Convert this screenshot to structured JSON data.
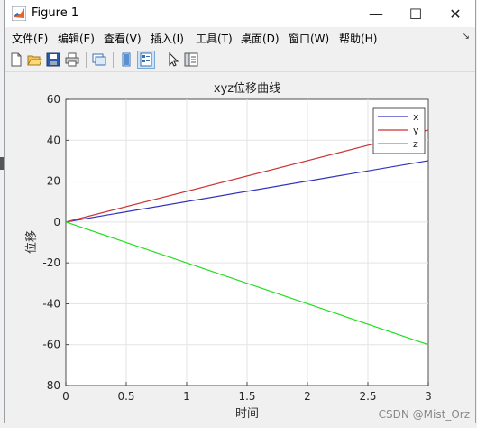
{
  "window": {
    "title": "Figure 1",
    "minimize_glyph": "—",
    "maximize_glyph": "☐",
    "close_glyph": "✕"
  },
  "menu": {
    "items": [
      {
        "label": "文件(F)"
      },
      {
        "label": "编辑(E)"
      },
      {
        "label": "查看(V)"
      },
      {
        "label": "插入(I)"
      },
      {
        "label": "工具(T)"
      },
      {
        "label": "桌面(D)"
      },
      {
        "label": "窗口(W)"
      },
      {
        "label": "帮助(H)"
      }
    ],
    "overflow_glyph": "↘"
  },
  "toolbar": {
    "icons": [
      "new-figure-icon",
      "open-file-icon",
      "save-icon",
      "print-icon",
      "link-plot-icon",
      "hide-plot-tools-icon",
      "show-plot-tools-icon",
      "edit-plot-arrow-icon",
      "open-property-inspector-icon"
    ]
  },
  "chart_data": {
    "type": "line",
    "title": "xyz位移曲线",
    "xlabel": "时间",
    "ylabel": "位移",
    "xlim": [
      0,
      3
    ],
    "ylim": [
      -80,
      60
    ],
    "xticks": [
      0,
      0.5,
      1,
      1.5,
      2,
      2.5,
      3
    ],
    "xtick_labels": [
      "0",
      "0.5",
      "1",
      "1.5",
      "2",
      "2.5",
      "3"
    ],
    "yticks": [
      -80,
      -60,
      -40,
      -20,
      0,
      20,
      40,
      60
    ],
    "ytick_labels": [
      "-80",
      "-60",
      "-40",
      "-20",
      "0",
      "20",
      "40",
      "60"
    ],
    "grid": true,
    "legend_position": "top-right",
    "series": [
      {
        "name": "x",
        "color": "#3333bb",
        "x": [
          0,
          3
        ],
        "y": [
          0,
          30
        ]
      },
      {
        "name": "y",
        "color": "#cc3333",
        "x": [
          0,
          3
        ],
        "y": [
          0,
          45
        ]
      },
      {
        "name": "z",
        "color": "#22dd22",
        "x": [
          0,
          3
        ],
        "y": [
          0,
          -60
        ]
      }
    ]
  },
  "watermark": "CSDN @Mist_Orz"
}
